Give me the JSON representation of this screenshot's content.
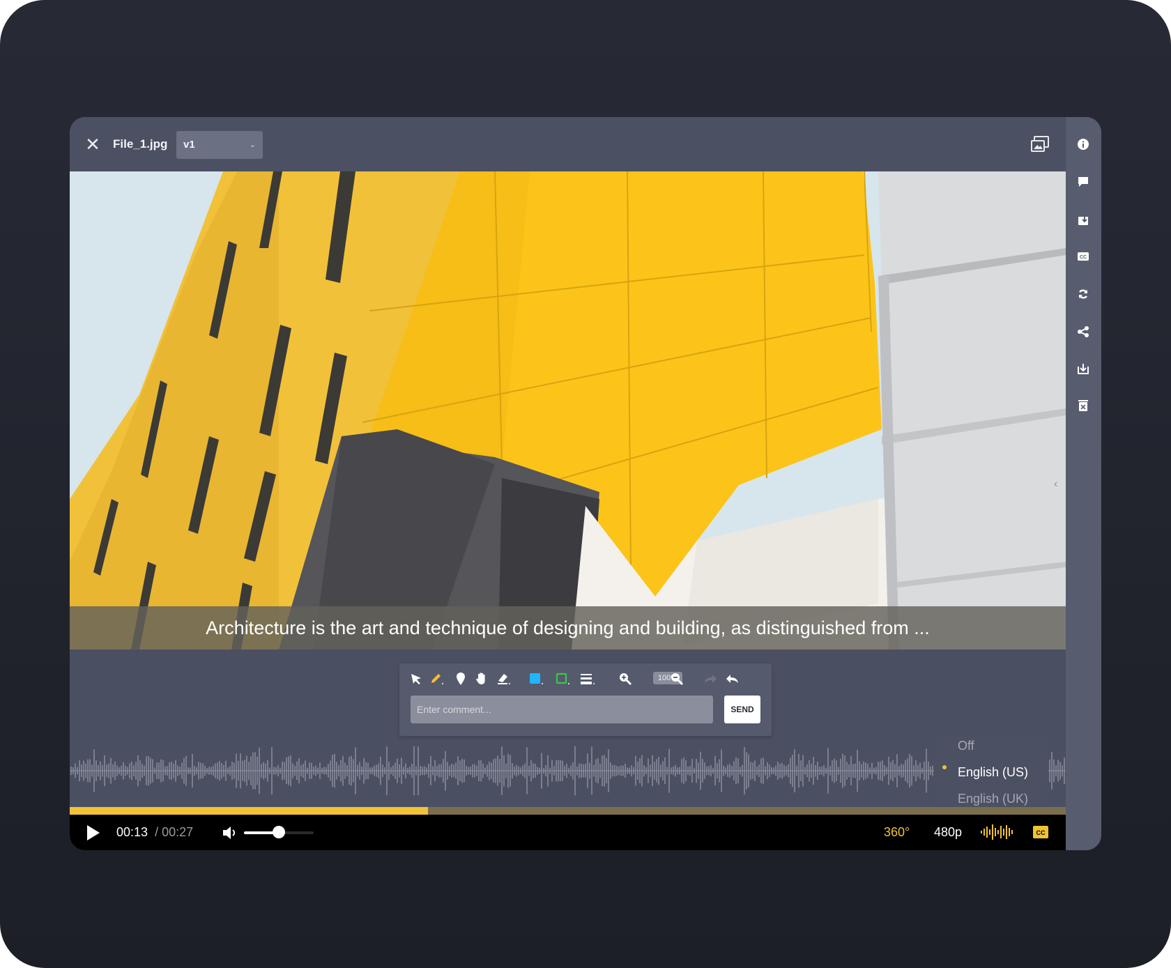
{
  "window": {
    "file_name": "File_1.jpg",
    "version": "v1"
  },
  "viewer": {
    "subtitle": "Architecture is the art and technique of designing and building, as distinguished from ..."
  },
  "annotation_toolbar": {
    "tools": [
      "pointer-icon",
      "pencil-icon",
      "pin-icon",
      "hand-icon",
      "eraser-icon",
      "fill-color-icon",
      "stroke-color-icon",
      "line-width-icon",
      "zoom-in-icon",
      "zoom-out-icon",
      "redo-icon",
      "undo-icon"
    ],
    "zoom_level": "100%",
    "comment_placeholder": "Enter comment...",
    "send_label": "SEND"
  },
  "sidebar": {
    "items": [
      "info-icon",
      "comment-icon",
      "version-upload-icon",
      "captions-icon",
      "refresh-icon",
      "share-icon",
      "download-icon",
      "delete-icon"
    ]
  },
  "player": {
    "current_time": "00:13",
    "duration": "/ 00:27",
    "progress": 0.36,
    "volume": 0.5,
    "projection": "360°",
    "quality": "480p"
  },
  "captions_menu": {
    "options": [
      "Off",
      "English (US)",
      "English (UK)"
    ],
    "selected": "English (US)"
  },
  "colors": {
    "accent": "#f1c232",
    "fill_color": "#1fb6ff",
    "stroke_color": "#39c84a",
    "window_bg": "#4b4f62"
  }
}
